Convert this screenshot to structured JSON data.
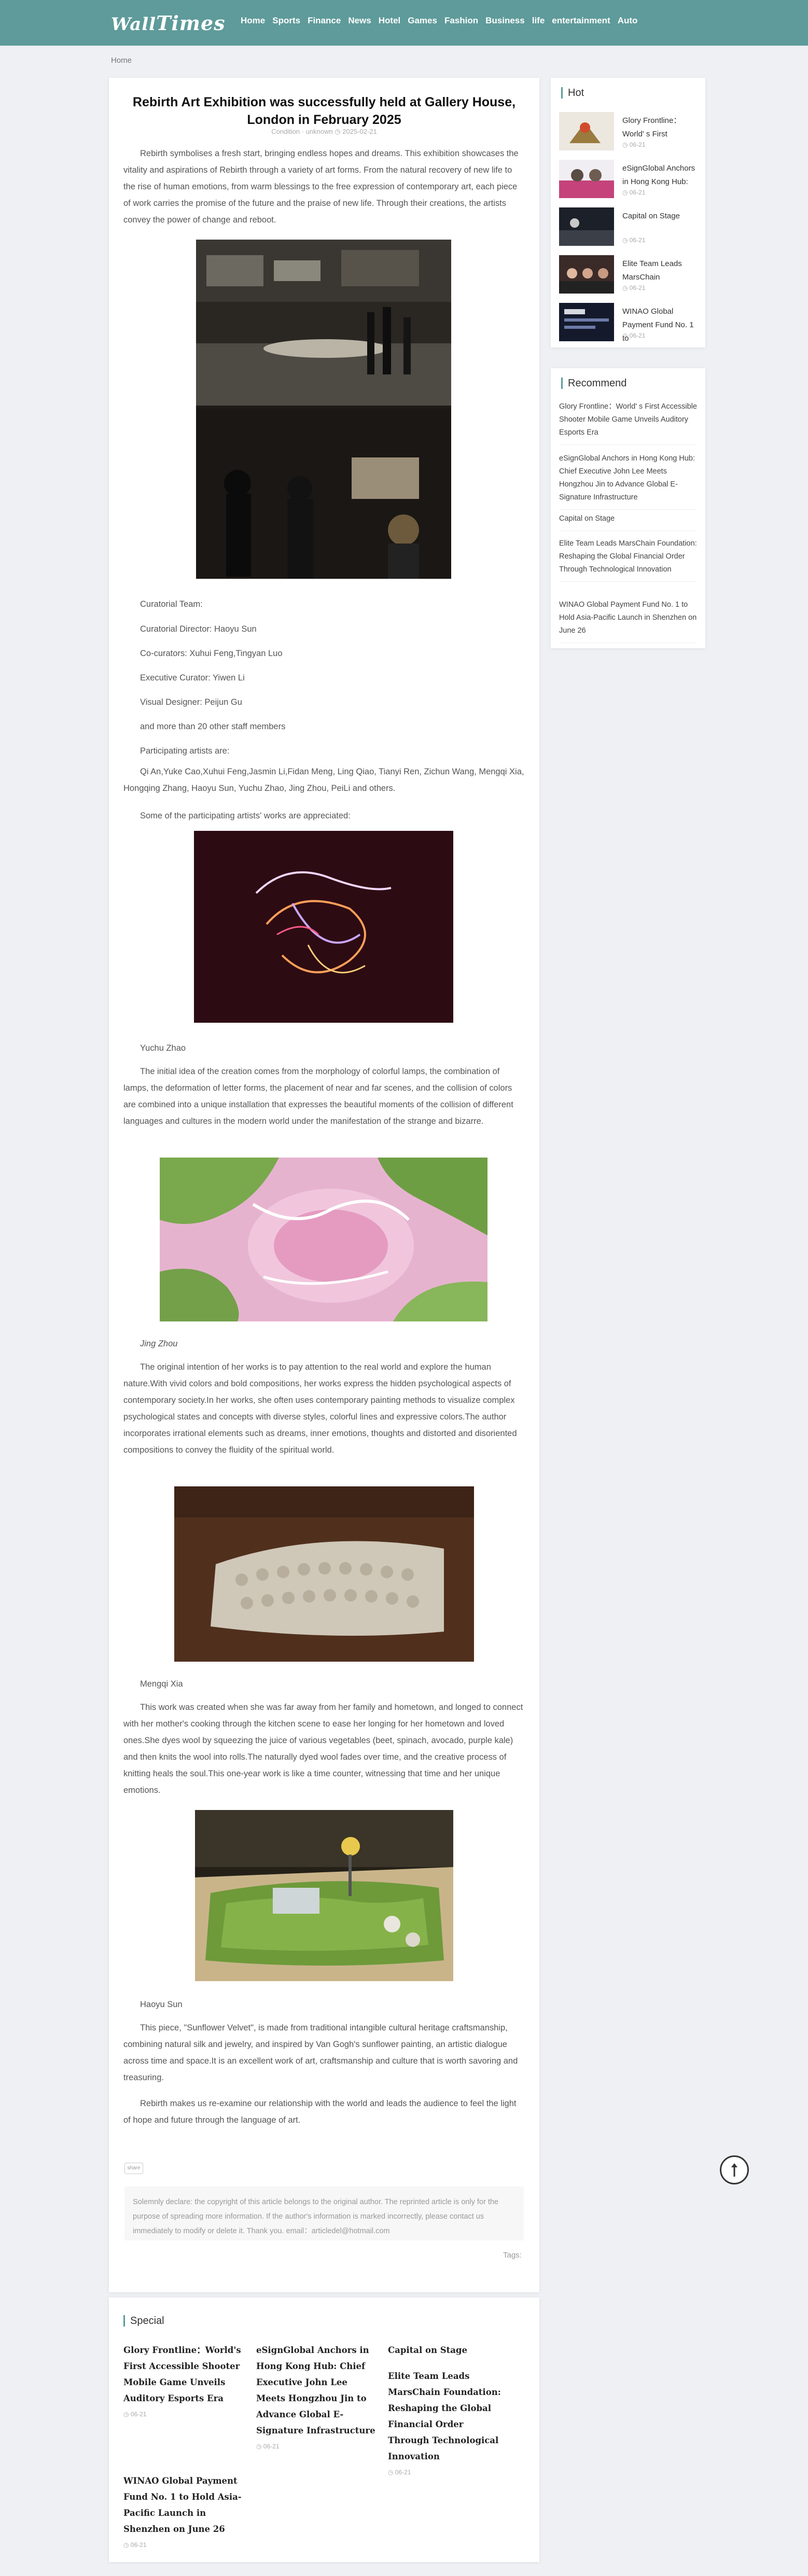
{
  "header": {
    "logo_part1": "Wall",
    "logo_part2": "Times",
    "nav": [
      "Home",
      "Sports",
      "Finance",
      "News",
      "Hotel",
      "Games",
      "Fashion",
      "Business",
      "life",
      "entertainment",
      "Auto"
    ]
  },
  "breadcrumb": "Home",
  "article": {
    "title": "Rebirth Art Exhibition was successfully held at Gallery House, London in February 2025",
    "meta": "Condition · unknown ◷ 2025-02-21",
    "intro": "Rebirth symbolises a fresh start, bringing endless hopes and dreams. This exhibition showcases the vitality and aspirations of Rebirth through a variety of art forms. From the natural recovery of new life to the rise of human emotions, from warm blessings to the free expression of contemporary art, each piece of work carries the promise of the future and the praise of new life. Through their creations, the artists convey the power of change and reboot.",
    "team_heading": "Curatorial Team:",
    "director": "Curatorial Director: Haoyu Sun",
    "cocurators": "Co-curators: Xuhui Feng,Tingyan Luo",
    "executive": "Executive Curator: Yiwen Li",
    "designer": "Visual Designer: Peijun Gu",
    "staff": "and more than 20 other staff members",
    "artists_heading": "Participating artists are:",
    "artists": "Qi An,Yuke Cao,Xuhui Feng,Jasmin Li,Fidan Meng, Ling Qiao, Tianyi Ren, Zichun Wang, Mengqi Xia, Hongqing Zhang, Haoyu Sun, Yuchu Zhao, Jing Zhou, PeiLi and others.",
    "works_intro": "Some of the participating artists' works are appreciated:",
    "artist1": "Yuchu Zhao",
    "artist1_desc": "The initial idea of the creation comes from the morphology of colorful lamps, the combination of lamps, the deformation of letter forms, the placement of near and far scenes, and the collision of colors are combined into a unique installation that expresses the beautiful moments of the collision of different languages and cultures in the modern world under the manifestation of the strange and bizarre.",
    "artist2": "Jing Zhou",
    "artist2_desc": "The original intention of her works is to pay attention to the real world and explore the human nature.With vivid colors and bold compositions, her works express the hidden psychological aspects of contemporary society.In her works, she often uses contemporary painting methods to visualize complex psychological states and concepts with diverse styles, colorful lines and expressive colors.The author incorporates irrational elements such as dreams, inner emotions, thoughts and distorted and disoriented compositions to convey the fluidity of the spiritual world.",
    "artist3": "Mengqi Xia",
    "artist3_desc": "This work was created when she was far away from her family and hometown, and longed to connect with her mother's cooking through the kitchen scene to ease her longing for her hometown and loved ones.She dyes wool by squeezing the juice of various vegetables (beet, spinach, avocado, purple kale) and then knits the wool into rolls.The naturally dyed wool fades over time, and the creative process of knitting heals the soul.This one-year work is like a time counter, witnessing that time and her unique emotions.",
    "artist4": "Haoyu Sun",
    "artist4_desc": "This piece, \"Sunflower Velvet\", is made from traditional intangible cultural heritage craftsmanship, combining natural silk and jewelry, and inspired by Van Gogh's sunflower painting, an artistic dialogue across time and space.It is an excellent work of art, craftsmanship and culture that is worth savoring and treasuring.",
    "closing": "Rebirth makes us re-examine our relationship with the world and leads the audience to feel the light of hope and future through the language of art.",
    "tag_button": "share",
    "notice": "Solemnly declare: the copyright of this article belongs to the original author. The reprinted article is only for the purpose of spreading more information. If the author's information is marked incorrectly, please contact us immediately to modify or delete it. Thank you. email：articledel@hotmail.com",
    "tags_label": "Tags:"
  },
  "hot": {
    "heading": "Hot",
    "items": [
      {
        "title": "Glory Frontline：World' s First",
        "date": "◷ 06-21"
      },
      {
        "title": "eSignGlobal Anchors in Hong Kong Hub:",
        "date": "◷ 06-21"
      },
      {
        "title": "Capital on Stage",
        "date": "◷ 06-21"
      },
      {
        "title": "Elite Team Leads MarsChain",
        "date": "◷ 06-21"
      },
      {
        "title": "WINAO Global Payment Fund No. 1 to",
        "date": "◷ 06-21"
      }
    ]
  },
  "recommend": {
    "heading": "Recommend",
    "items": [
      "Glory Frontline：World' s First Accessible Shooter Mobile Game Unveils Auditory Esports Era",
      "eSignGlobal Anchors in Hong Kong Hub: Chief Executive John Lee Meets Hongzhou Jin to Advance Global E-Signature Infrastructure",
      "Capital on Stage",
      "Elite Team Leads MarsChain Foundation: Reshaping the Global Financial Order Through Technological Innovation",
      "WINAO Global Payment Fund No. 1 to Hold Asia-Pacific Launch in Shenzhen on June 26"
    ]
  },
  "special": {
    "heading": "Special",
    "items": [
      {
        "title": "Glory Frontline：World's First Accessible Shooter Mobile Game Unveils Auditory Esports Era",
        "date": "◷ 06-21"
      },
      {
        "title": "eSignGlobal Anchors in Hong Kong Hub: Chief Executive John Lee Meets Hongzhou Jin to Advance Global E-Signature Infrastructure",
        "date": "◷ 06-21"
      },
      {
        "title": "Capital on Stage",
        "date": ""
      },
      {
        "title": "Elite Team Leads MarsChain Foundation: Reshaping the Global Financial Order Through Technological Innovation",
        "date": "◷ 06-21"
      },
      {
        "title": "WINAO Global Payment Fund No. 1 to Hold Asia-Pacific Launch in Shenzhen on June 26",
        "date": "◷ 06-21"
      }
    ]
  },
  "colors": {
    "header": "#5e9b9a",
    "page_bg": "#eef0f4"
  },
  "icons": {
    "back_to_top": "arrow-up-icon",
    "clock": "clock-icon"
  }
}
